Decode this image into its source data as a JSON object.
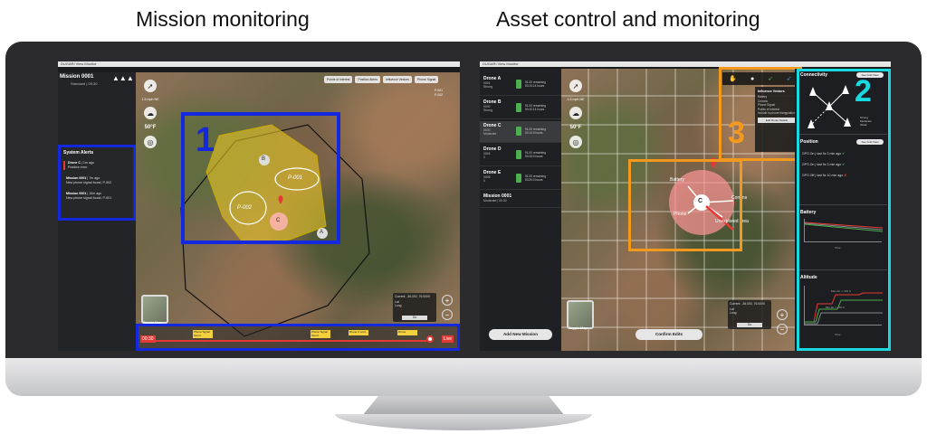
{
  "headlines": {
    "left": "Mission monitoring",
    "right": "Asset control and monitoring"
  },
  "left_screen": {
    "window_title": "DUGARI View Monitor",
    "mission": {
      "name": "Mission 0001",
      "sub": "Standard | 00:30"
    },
    "tools": {
      "speed": "1.5 mph NE",
      "temp": "50°F"
    },
    "chips": [
      "Points of Interest",
      "Position Alerts",
      "Influence Vectors",
      "Phone Signal"
    ],
    "phone_signal": [
      "P-001",
      "P-002"
    ],
    "alerts": {
      "title": "System Alerts",
      "items": [
        {
          "head": "Drone C",
          "time": "1m ago",
          "text": "Position error"
        },
        {
          "head": "Mission 0001",
          "time": "7m ago",
          "text": "New phone signal found, P-002"
        },
        {
          "head": "Mission 0001",
          "time": "10m ago",
          "text": "New phone signal found, P-001"
        }
      ]
    },
    "map_labels": {
      "p1": "P-001",
      "p2": "P-002",
      "drones": [
        "B",
        "C",
        "A"
      ]
    },
    "box_number": "1",
    "timeline": {
      "start": "00:30",
      "end": "Live",
      "flags": [
        "Phone Signal found",
        "Phone Signal found",
        "Drone C error",
        "Drone"
      ]
    },
    "toggle_map": "Toggle Map",
    "coords": {
      "current": "Current: -36.000, 76.0000",
      "lat": "Lat",
      "long": "Long",
      "go": "Go"
    }
  },
  "right_screen": {
    "window_title": "DUGARI View Monitor",
    "drones": [
      {
        "name": "Drone A",
        "id": "0001",
        "signal": "Strong",
        "battery": "91.00 remaining",
        "time": "00:10:14 hours"
      },
      {
        "name": "Drone B",
        "id": "0002",
        "signal": "Strong",
        "battery": "91.00 remaining",
        "time": "00:10:14 hours"
      },
      {
        "name": "Drone C",
        "id": "0003",
        "signal": "Moderate",
        "battery": "91.00 remaining",
        "time": "00:10:0 hours"
      },
      {
        "name": "Drone D",
        "id": "0004",
        "signal": "0",
        "battery": "91.00 remaining",
        "time": "00:15:0 hours"
      },
      {
        "name": "Drone E",
        "id": "0005",
        "signal": "0",
        "battery": "91.00 remaining",
        "time": "00:20:0 hours"
      }
    ],
    "mission": {
      "name": "Mission 0001",
      "sub": "Moderate | 00:30"
    },
    "tools": {
      "speed": "1.5 mph NE",
      "temp": "50°F"
    },
    "sensor": {
      "title": "Influence Vectors",
      "items": [
        "Battery",
        "Comms",
        "Phone Signal",
        "Points of Interest",
        "Include in phone triangulation"
      ],
      "button": "Edit Route Details"
    },
    "vector_labels": [
      "Battery",
      "Comms",
      "Phone",
      "Unexplored area"
    ],
    "center_drone": "C",
    "add_mission": "Add New Mission",
    "confirm_edits": "Confirm Edits",
    "toggle_map": "Toggle Map",
    "coords": {
      "current": "Current: -36.000, 76.0000",
      "lat": "Lat",
      "long": "Long",
      "go": "Go"
    },
    "panel": {
      "connectivity": "Connectivity",
      "see_grid": "See Grid View",
      "legend": [
        "Strong",
        "Moderate",
        "Weak"
      ],
      "position": "Position",
      "gps": [
        {
          "label": "GPS On",
          "time": "last fix 3 min ago",
          "ok": true
        },
        {
          "label": "GPS On",
          "time": "last fix 3 min ago",
          "ok": true
        },
        {
          "label": "GPS Off",
          "time": "last fix 10 min ago",
          "ok": false
        }
      ],
      "battery": "Battery",
      "altitude": "Altitude",
      "alt_max": "Max Alt. = 370 ft",
      "alt_min": "Min Alt. = 150 ft",
      "time_label": "Time"
    },
    "box_numbers": {
      "panel": "2",
      "sensor": "3"
    }
  },
  "colors": {
    "blue_box": "#1428e0",
    "orange_box": "#f39a1e",
    "cyan_box": "#19d8e0"
  }
}
